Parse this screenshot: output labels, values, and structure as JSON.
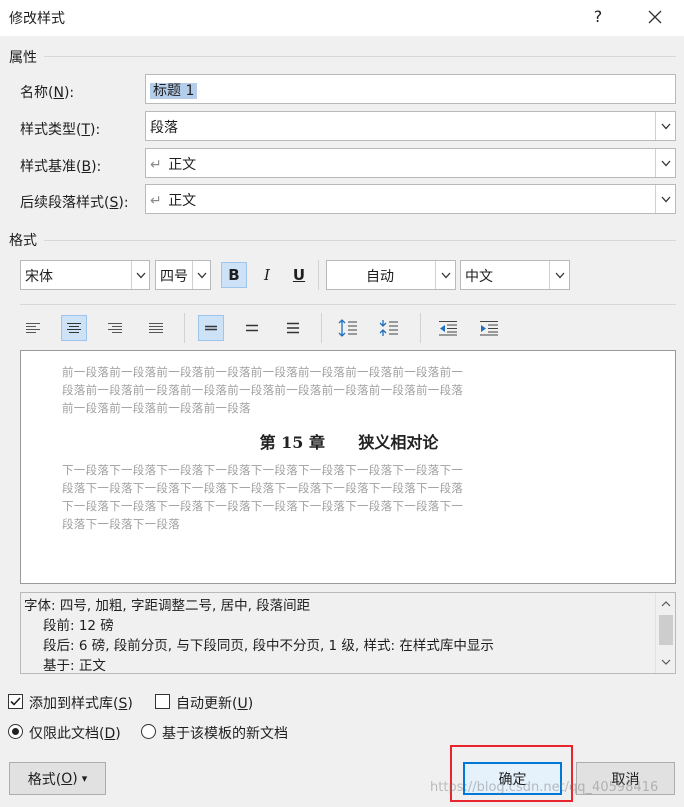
{
  "window": {
    "title": "修改样式",
    "help_label": "?",
    "close_label": "✕"
  },
  "properties": {
    "group_label": "属性",
    "name_label": "名称(",
    "name_key": "N",
    "name_suffix": "):",
    "name_value": "标题 1",
    "type_label": "样式类型(",
    "type_key": "T",
    "type_suffix": "):",
    "type_value": "段落",
    "base_label": "样式基准(",
    "base_key": "B",
    "base_suffix": "):",
    "base_value": "正文",
    "next_label": "后续段落样式(",
    "next_key": "S",
    "next_suffix": "):",
    "next_value": "正文",
    "para_mark": "↵"
  },
  "format": {
    "group_label": "格式",
    "font": "宋体",
    "size": "四号",
    "bold": "B",
    "italic": "I",
    "underline": "U",
    "color": "自动",
    "language": "中文"
  },
  "preview": {
    "before_lines": [
      "前一段落前一段落前一段落前一段落前一段落前一段落前一段落前一段落前一",
      "段落前一段落前一段落前一段落前一段落前一段落前一段落前一段落前一段落",
      "前一段落前一段落前一段落前一段落"
    ],
    "heading": "第 15 章      狭义相对论",
    "after_lines": [
      "下一段落下一段落下一段落下一段落下一段落下一段落下一段落下一段落下一",
      "段落下一段落下一段落下一段落下一段落下一段落下一段落下一段落下一段落",
      "下一段落下一段落下一段落下一段落下一段落下一段落下一段落下一段落下一",
      "段落下一段落下一段落"
    ]
  },
  "description": {
    "line1": "字体: 四号, 加粗, 字距调整二号, 居中, 段落间距",
    "line2": "段前: 12 磅",
    "line3": "段后: 6 磅, 段前分页, 与下段同页, 段中不分页, 1 级, 样式: 在样式库中显示",
    "line4": "基于: 正文"
  },
  "options": {
    "add_gallery": "添加到样式库(",
    "add_gallery_key": "S",
    "add_gallery_suffix": ")",
    "add_gallery_checked": true,
    "auto_update": "自动更新(",
    "auto_update_key": "U",
    "auto_update_suffix": ")",
    "auto_update_checked": false,
    "only_doc": "仅限此文档(",
    "only_doc_key": "D",
    "only_doc_suffix": ")",
    "only_doc_selected": true,
    "template": "基于该模板的新文档",
    "template_selected": false
  },
  "buttons": {
    "format": "格式(",
    "format_key": "O",
    "format_suffix": ")",
    "format_arrow": "▾",
    "ok": "确定",
    "cancel": "取消"
  },
  "watermark": "https://blog.csdn.net/qq_40598416",
  "colors": {
    "accent": "#0078d7",
    "highlight": "#e8242c"
  }
}
